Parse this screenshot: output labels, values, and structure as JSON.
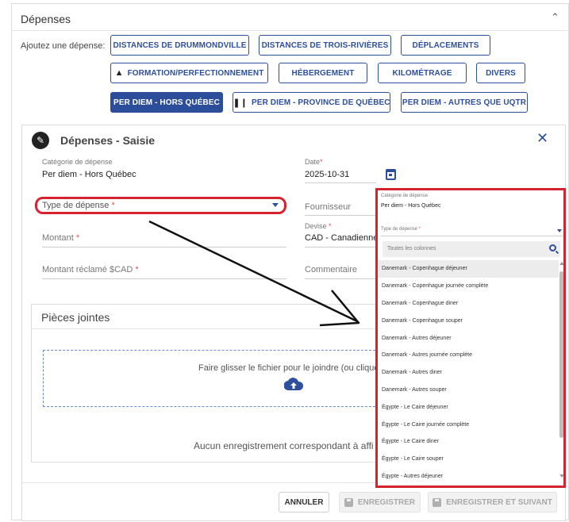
{
  "panel": {
    "title": "Dépenses"
  },
  "add_expense": {
    "label": "Ajoutez une dépense:",
    "buttons": [
      "DISTANCES DE DRUMMONDVILLE",
      "DISTANCES DE TROIS-RIVIÈRES",
      "DÉPLACEMENTS",
      "FORMATION/PERFECTIONNEMENT",
      "HÉBERGEMENT",
      "KILOMÉTRAGE",
      "DIVERS",
      "PER DIEM - HORS QUÉBEC",
      "PER DIEM - PROVINCE DE QUÉBEC",
      "PER DIEM - AUTRES QUE UQTR"
    ],
    "active": "PER DIEM - HORS QUÉBEC"
  },
  "form": {
    "title": "Dépenses - Saisie",
    "categorie_label": "Catégorie de dépense",
    "categorie_value": "Per diem - Hors Québec",
    "date_label": "Date",
    "date_value": "2025-10-31",
    "type_label": "Type de dépense",
    "fournisseur_label": "Fournisseur",
    "devise_label": "Devise",
    "devise_value": "CAD - Canadienne",
    "montant_label": "Montant",
    "montant_reclame_label": "Montant réclamé $CAD",
    "commentaire_label": "Commentaire",
    "required_mark": "*"
  },
  "attachments": {
    "title": "Pièces jointes",
    "drop_text": "Faire glisser le fichier pour le joindre (ou cliquer",
    "empty_text": "Aucun enregistrement correspondant à affi"
  },
  "footer": {
    "cancel": "ANNULER",
    "save": "ENREGISTRER",
    "save_next": "ENREGISTRER ET SUIVANT"
  },
  "dropdown": {
    "categorie_label": "Catégorie de dépense",
    "categorie_value": "Per diem - Hors Québec",
    "type_label": "Type de dépense",
    "search_placeholder": "Toutes les colonnes",
    "options": [
      "Danemark - Copenhague déjeuner",
      "Danemark - Copenhague journée complète",
      "Danemark - Copenhague diner",
      "Danemark - Copenhague souper",
      "Danemark - Autres déjeuner",
      "Danemark - Autres journée complète",
      "Danemark - Autres diner",
      "Danemark - Autres souper",
      "Égypte - Le Caire déjeuner",
      "Égypte - Le Caire journée complète",
      "Égypte - Le Caire diner",
      "Égypte - Le Caire souper",
      "Égypte - Autres déjeuner"
    ]
  },
  "colors": {
    "primary": "#2e4f9b",
    "active_button": "#2c4d9a",
    "highlight_red": "#d6232f",
    "required": "#d9534f"
  },
  "icons": [
    "chevron-up-icon",
    "graduation-cap-icon",
    "fork-knife-icon",
    "pencil-icon",
    "close-icon",
    "calendar-icon",
    "cloud-upload-icon",
    "save-icon",
    "search-icon",
    "annotation-arrow"
  ]
}
